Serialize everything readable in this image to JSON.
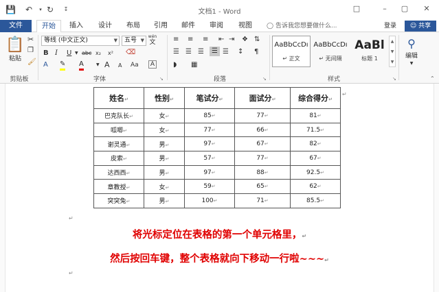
{
  "window": {
    "title": "文档1 - Word",
    "save_icon": "save-icon",
    "undo_icon": "undo-icon",
    "redo_icon": "redo-icon",
    "customize_icon": "customize-icon",
    "ribbon_options_icon": "ribbon-display-icon",
    "minimize_icon": "minimize-icon",
    "maximize_icon": "maximize-icon",
    "close_icon": "close-icon"
  },
  "tabs": {
    "file": "文件",
    "items": [
      "开始",
      "插入",
      "设计",
      "布局",
      "引用",
      "邮件",
      "审阅",
      "视图"
    ],
    "active": "开始",
    "tell_me": "告诉我您想要做什么...",
    "login": "登录",
    "share": "共享"
  },
  "ribbon": {
    "clipboard": {
      "paste": "粘贴",
      "label": "剪贴板"
    },
    "font": {
      "font_name": "等线 (中文正文)",
      "font_size": "五号",
      "wen": "wén",
      "wen_char": "文",
      "bold": "B",
      "italic": "I",
      "underline": "U",
      "strike": "abc",
      "subscript": "x₂",
      "superscript": "x²",
      "font_color_a": "A",
      "highlight": "A",
      "grow": "A",
      "shrink": "A",
      "case": "Aa",
      "label": "字体"
    },
    "paragraph": {
      "label": "段落"
    },
    "styles": {
      "items": [
        {
          "sample": "AaBbCcDı",
          "name": "↵ 正文"
        },
        {
          "sample": "AaBbCcDı",
          "name": "↵ 无间隔"
        },
        {
          "sample": "AaBl",
          "name": "标题 1"
        }
      ],
      "label": "样式"
    },
    "editing": {
      "label": "编辑"
    }
  },
  "table": {
    "headers": [
      "姓名",
      "性别",
      "笔试分",
      "面试分",
      "综合得分"
    ],
    "rows": [
      [
        "巴克队长",
        "女",
        "85",
        "77",
        "81"
      ],
      [
        "呱唧",
        "女",
        "77",
        "66",
        "71.5"
      ],
      [
        "谢灵通",
        "男",
        "97",
        "67",
        "82"
      ],
      [
        "皮索",
        "男",
        "57",
        "77",
        "67"
      ],
      [
        "达西西",
        "男",
        "97",
        "88",
        "92.5"
      ],
      [
        "章教授",
        "女",
        "59",
        "65",
        "62"
      ],
      [
        "突突兔",
        "男",
        "100",
        "71",
        "85.5"
      ]
    ]
  },
  "mark": "↵",
  "captions": [
    "将光标定位在表格的第一个单元格里，",
    "然后按回车键，整个表格就向下移动一行啦~~~"
  ]
}
